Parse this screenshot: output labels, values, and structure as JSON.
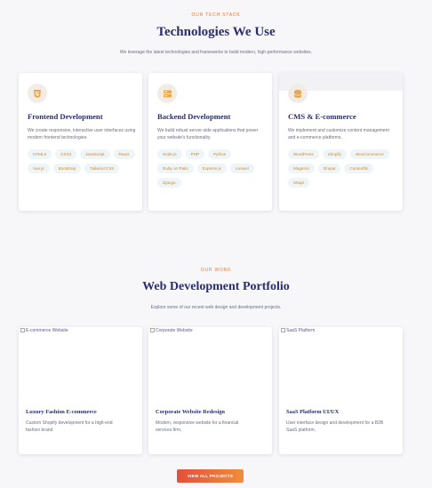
{
  "tech_section": {
    "eyebrow": "OUR TECH STACK",
    "title": "Technologies We Use",
    "subtitle": "We leverage the latest technologies and frameworks to build modern, high-performance websites.",
    "cards": [
      {
        "icon": "html5-icon",
        "title": "Frontend Development",
        "desc": "We create responsive, interactive user interfaces using modern frontend technologies.",
        "tags": [
          "HTML5",
          "CSS3",
          "JavaScript",
          "React",
          "Vue.js",
          "Bootstrap",
          "Tailwind CSS"
        ]
      },
      {
        "icon": "server-icon",
        "title": "Backend Development",
        "desc": "We build robust server-side applications that power your website's functionality.",
        "tags": [
          "Node.js",
          "PHP",
          "Python",
          "Ruby on Rails",
          "Express.js",
          "Laravel",
          "Django"
        ]
      },
      {
        "icon": "database-icon",
        "title": "CMS & E-commerce",
        "desc": "We implement and customize content management and e-commerce platforms.",
        "tags": [
          "WordPress",
          "Shopify",
          "WooCommerce",
          "Magento",
          "Drupal",
          "Contentful",
          "Strapi"
        ]
      }
    ]
  },
  "portfolio_section": {
    "eyebrow": "OUR WORK",
    "title": "Web Development Portfolio",
    "subtitle": "Explore some of our recent web design and development projects.",
    "items": [
      {
        "img_alt": "E-commerce Website",
        "title": "Luxury Fashion E-commerce",
        "desc": "Custom Shopify development for a high-end fashion brand."
      },
      {
        "img_alt": "Corporate Website",
        "title": "Corporate Website Redesign",
        "desc": "Modern, responsive website for a financial services firm."
      },
      {
        "img_alt": "SaaS Platform",
        "title": "SaaS Platform UI/UX",
        "desc": "User interface design and development for a B2B SaaS platform."
      }
    ],
    "cta_label": "VIEW ALL PROJECTS"
  },
  "colors": {
    "accent": "#e8792c",
    "heading": "#2a2f6d",
    "tag_bg": "#eef5f8",
    "tag_text": "#c98a3c"
  }
}
